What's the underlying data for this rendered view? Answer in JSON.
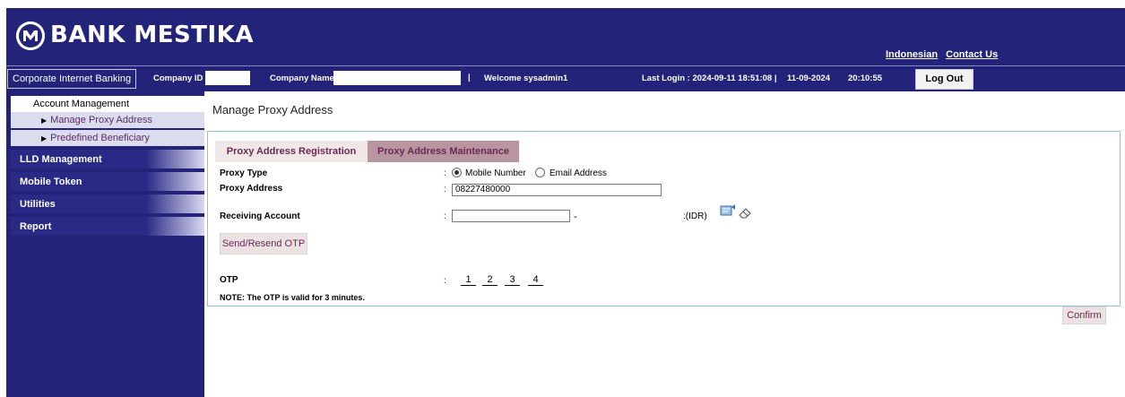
{
  "header": {
    "brand": "BANK MESTIKA",
    "links": [
      "Indonesian",
      "Contact Us"
    ]
  },
  "infobar": {
    "app_name": "Corporate Internet Banking",
    "company_id_label": "Company ID",
    "company_name_label": "Company Name",
    "separator": "|",
    "welcome": "Welcome sysadmin1",
    "last_login": "Last Login : 2024-09-11 18:51:08  |",
    "date": "11-09-2024",
    "time": "20:10:55",
    "logout": "Log Out"
  },
  "sidebar": {
    "section": "Account Management",
    "sub_items": [
      "Manage Proxy Address",
      "Predefined Beneficiary"
    ],
    "items": [
      "LLD Management",
      "Mobile Token",
      "Utilities",
      "Report"
    ]
  },
  "main": {
    "title": "Manage Proxy Address",
    "tabs": [
      "Proxy Address Registration",
      "Proxy Address Maintenance"
    ],
    "fields": {
      "proxy_type_label": "Proxy Type",
      "proxy_type_options": [
        "Mobile Number",
        "Email Address"
      ],
      "proxy_type_selected": "Mobile Number",
      "proxy_address_label": "Proxy Address",
      "proxy_address_value": "08227480000",
      "receiving_account_label": "Receiving Account",
      "receiving_account_value": "",
      "dash": "-",
      "currency": ":(IDR)",
      "colon": ":"
    },
    "send_otp_button": "Send/Resend OTP",
    "otp_label": "OTP",
    "otp_digits": [
      "1",
      "2",
      "3",
      "4"
    ],
    "note": "NOTE: The OTP is valid for 3 minutes.",
    "confirm_button": "Confirm"
  },
  "colors": {
    "primary_navy": "#23237a",
    "tab_active": "#b8959f",
    "accent_text": "#6a2a55"
  }
}
